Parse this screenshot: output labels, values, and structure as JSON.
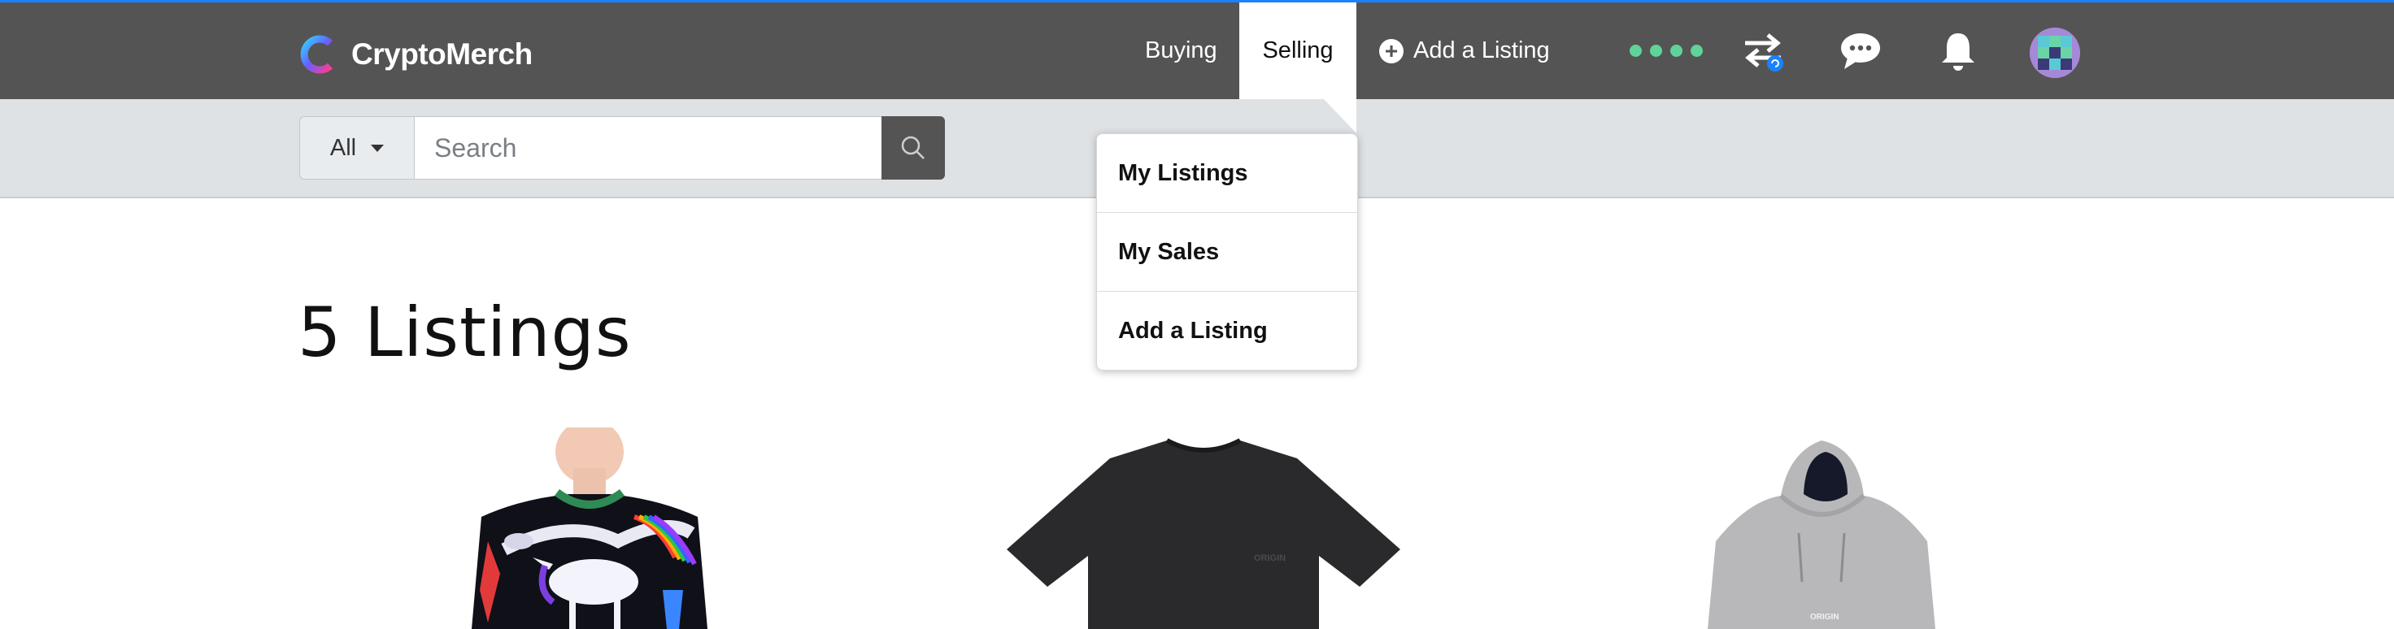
{
  "brand": {
    "name": "CryptoMerch"
  },
  "nav": {
    "buying": "Buying",
    "selling": "Selling",
    "add_listing": "Add a Listing"
  },
  "search": {
    "category": "All",
    "placeholder": "Search"
  },
  "selling_menu": {
    "items": [
      "My Listings",
      "My Sales",
      "Add a Listing"
    ]
  },
  "main": {
    "heading": "5 Listings"
  },
  "products": [
    {
      "name": "unicorn-print-tshirt",
      "logo_text": ""
    },
    {
      "name": "black-tshirt",
      "logo_text": "ORIGIN"
    },
    {
      "name": "grey-hoodie",
      "logo_text": "ORIGIN"
    }
  ],
  "colors": {
    "navbar": "#545454",
    "accent_line": "#1a82ff",
    "status_dots": "#5fd49a",
    "search_band": "#dfe2e5"
  }
}
